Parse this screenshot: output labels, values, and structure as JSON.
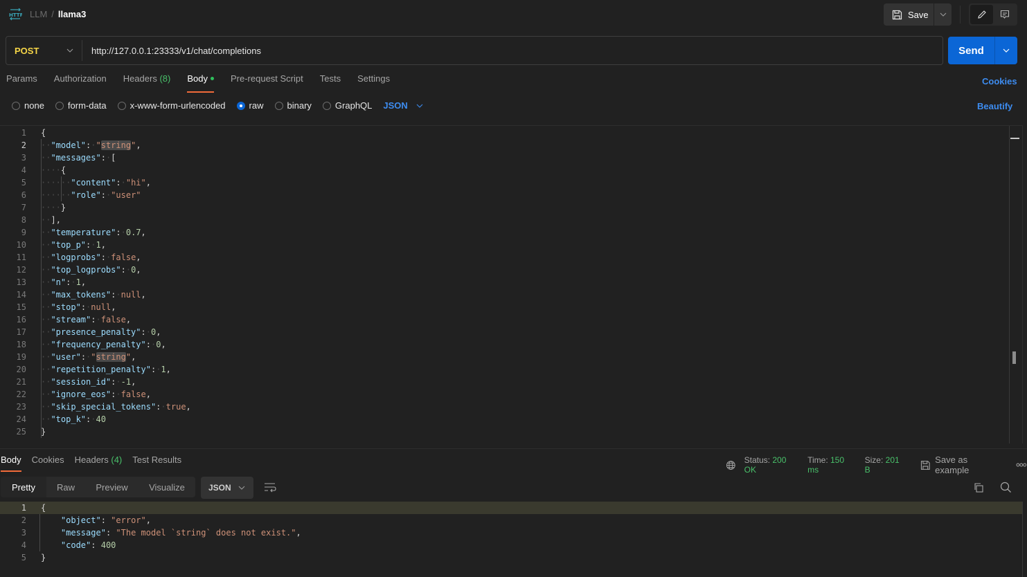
{
  "header": {
    "icon": "http-icon",
    "breadcrumb": {
      "parent": "LLM",
      "separator": "/",
      "current": "llama3"
    },
    "save_label": "Save",
    "icons": [
      "save-icon",
      "chevron-down-icon",
      "pencil-icon",
      "comment-icon"
    ]
  },
  "request": {
    "method": "POST",
    "url": "http://127.0.0.1:23333/v1/chat/completions",
    "send_label": "Send",
    "colors": {
      "method": "#f5d547",
      "send": "#0b66d6",
      "accent_tab": "#f26b3a",
      "link": "#3d8cf0",
      "success": "#49c06a"
    }
  },
  "request_tabs": [
    {
      "label": "Params",
      "active": false
    },
    {
      "label": "Authorization",
      "active": false
    },
    {
      "label": "Headers",
      "count": "(8)",
      "active": false
    },
    {
      "label": "Body",
      "active": true,
      "dot": true
    },
    {
      "label": "Pre-request Script",
      "active": false
    },
    {
      "label": "Tests",
      "active": false
    },
    {
      "label": "Settings",
      "active": false
    }
  ],
  "cookies_label": "Cookies",
  "body_types": [
    {
      "label": "none",
      "checked": false
    },
    {
      "label": "form-data",
      "checked": false
    },
    {
      "label": "x-www-form-urlencoded",
      "checked": false
    },
    {
      "label": "raw",
      "checked": true
    },
    {
      "label": "binary",
      "checked": false
    },
    {
      "label": "GraphQL",
      "checked": false
    }
  ],
  "body_language": "JSON",
  "beautify_label": "Beautify",
  "request_body_lines": [
    "{",
    "  \"model\": \"string\",",
    "  \"messages\": [",
    "    {",
    "      \"content\": \"hi\",",
    "      \"role\": \"user\"",
    "    }",
    "  ],",
    "  \"temperature\": 0.7,",
    "  \"top_p\": 1,",
    "  \"logprobs\": false,",
    "  \"top_logprobs\": 0,",
    "  \"n\": 1,",
    "  \"max_tokens\": null,",
    "  \"stop\": null,",
    "  \"stream\": false,",
    "  \"presence_penalty\": 0,",
    "  \"frequency_penalty\": 0,",
    "  \"user\": \"string\",",
    "  \"repetition_penalty\": 1,",
    "  \"session_id\": -1,",
    "  \"ignore_eos\": false,",
    "  \"skip_special_tokens\": true,",
    "  \"top_k\": 40",
    "}"
  ],
  "response": {
    "tabs": [
      {
        "label": "Body",
        "active": true
      },
      {
        "label": "Cookies",
        "active": false
      },
      {
        "label": "Headers",
        "count": "(4)",
        "active": false
      },
      {
        "label": "Test Results",
        "active": false
      }
    ],
    "status_label": "Status:",
    "status_value": "200 OK",
    "time_label": "Time:",
    "time_value": "150 ms",
    "size_label": "Size:",
    "size_value": "201 B",
    "save_example_label": "Save as example",
    "more_label": "ooo",
    "views": [
      "Pretty",
      "Raw",
      "Preview",
      "Visualize"
    ],
    "active_view": "Pretty",
    "language": "JSON",
    "body_lines": [
      "{",
      "    \"object\": \"error\",",
      "    \"message\": \"The model `string` does not exist.\",",
      "    \"code\": 400",
      "}"
    ]
  }
}
